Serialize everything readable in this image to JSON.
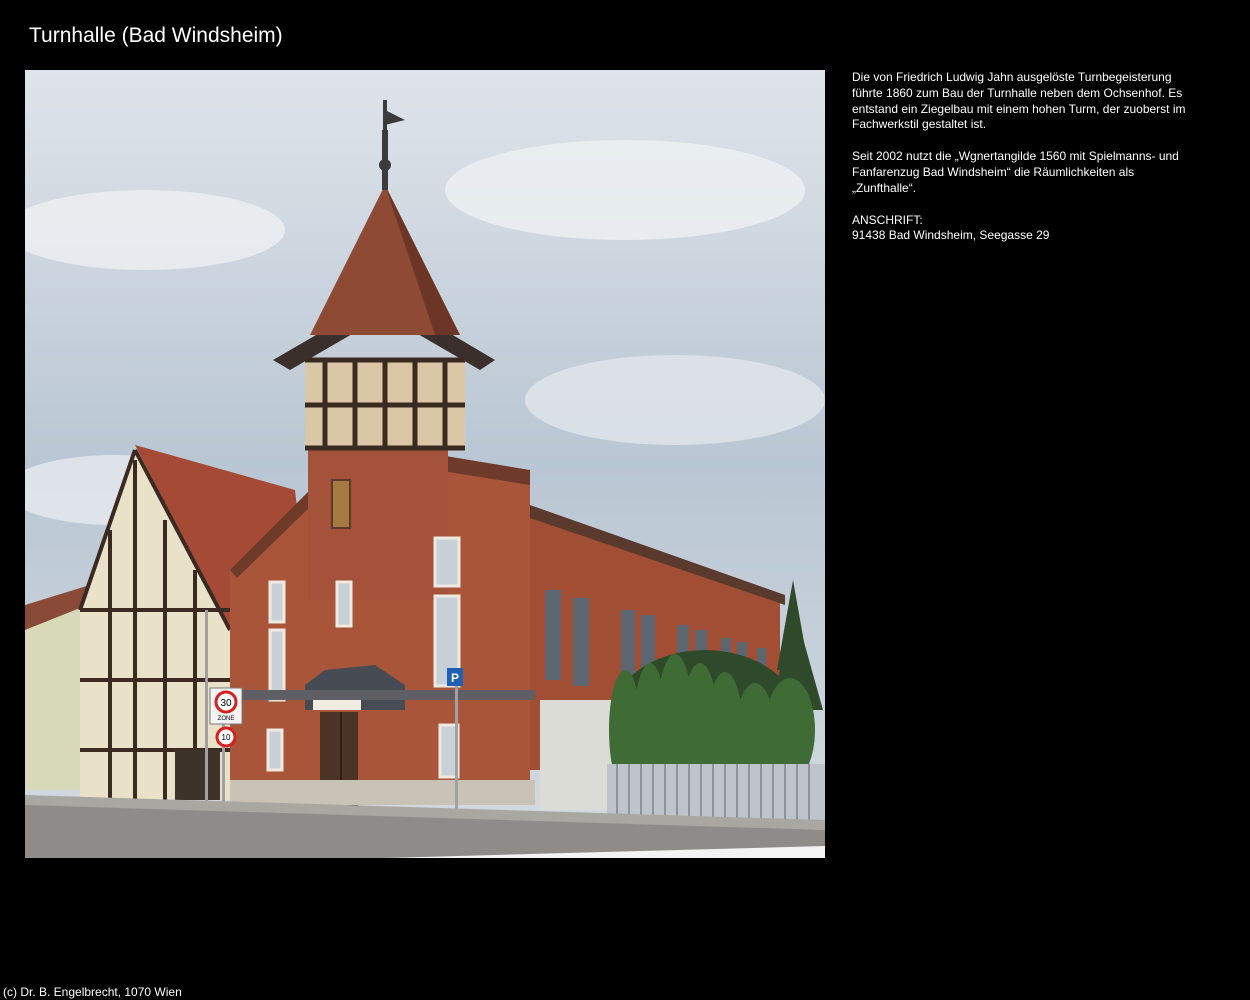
{
  "page": {
    "title": "Turnhalle (Bad Windsheim)"
  },
  "photo": {
    "road_signs": {
      "speed_limit_1": "30",
      "speed_limit_1_sub": "ZONE",
      "speed_limit_2": "10",
      "parking_sign": "P"
    }
  },
  "description": {
    "paragraph_1": "Die von Friedrich Ludwig Jahn ausgelöste Turnbegeisterung führte 1860 zum Bau der Turnhalle neben dem Ochsenhof. Es entstand ein Ziegelbau mit einem hohen Turm, der zuoberst im Fachwerkstil gestaltet ist.",
    "paragraph_2": "Seit 2002 nutzt die „Wgnertangilde 1560 mit Spielmanns- und Fanfarenzug Bad Windsheim“ die Räumlichkeiten als „Zunfthalle“.",
    "address_label": "ANSCHRIFT:",
    "address_value": "91438 Bad Windsheim, Seegasse 29"
  },
  "footer": {
    "copyright": "(c) Dr. B. Engelbrecht, 1070 Wien"
  },
  "colors": {
    "background": "#000000",
    "text": "#ffffff",
    "brick": "#9c4a32",
    "sky": "#c9d3dc"
  }
}
